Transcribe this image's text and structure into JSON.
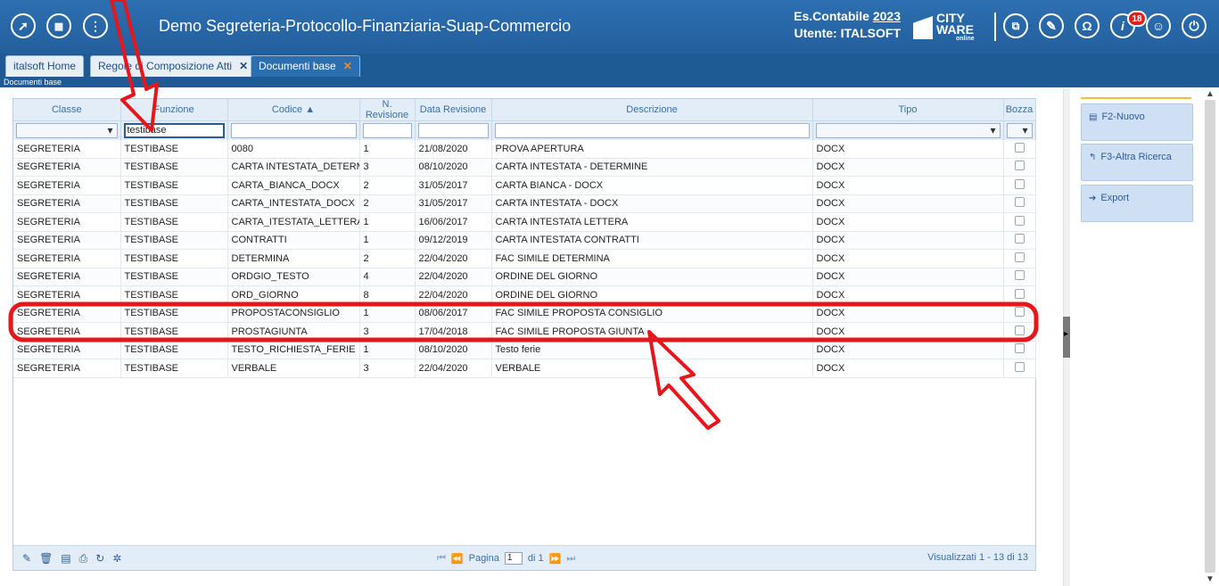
{
  "header": {
    "title": "Demo Segreteria-Protocollo-Finanziaria-Suap-Commercio",
    "es_label": "Es.Contabile",
    "es_year": "2023",
    "user_label": "Utente: ITALSOFT",
    "logo_line1": "CITY",
    "logo_line2": "WARE",
    "logo_line3": "online",
    "notifications": "18",
    "left_icons": [
      "rocket-icon",
      "apps-grid-icon",
      "info-menu-icon"
    ],
    "right_icons": [
      "windows-icon",
      "edit-icon",
      "headset-icon",
      "info-icon",
      "user-icon",
      "power-icon"
    ]
  },
  "tabs": [
    {
      "label": "italsoft Home",
      "closable": false,
      "active": false
    },
    {
      "label": "Regole di Composizione Atti",
      "closable": true,
      "active": false
    },
    {
      "label": "Documenti base",
      "closable": true,
      "active": true
    }
  ],
  "breadcrumb": "Documenti base",
  "grid": {
    "columns": [
      "Classe",
      "Funzione",
      "Codice ▲",
      "N. Revisione",
      "Data Revisione",
      "Descrizione",
      "Tipo",
      "Bozza"
    ],
    "filters": {
      "funzione": "testibase"
    },
    "rows": [
      [
        "SEGRETERIA",
        "TESTIBASE",
        "0080",
        "1",
        "21/08/2020",
        "PROVA APERTURA",
        "DOCX"
      ],
      [
        "SEGRETERIA",
        "TESTIBASE",
        "CARTA INTESTATA_DETERMINE",
        "3",
        "08/10/2020",
        "CARTA INTESTATA - DETERMINE",
        "DOCX"
      ],
      [
        "SEGRETERIA",
        "TESTIBASE",
        "CARTA_BIANCA_DOCX",
        "2",
        "31/05/2017",
        "CARTA BIANCA - DOCX",
        "DOCX"
      ],
      [
        "SEGRETERIA",
        "TESTIBASE",
        "CARTA_INTESTATA_DOCX",
        "2",
        "31/05/2017",
        "CARTA INTESTATA - DOCX",
        "DOCX"
      ],
      [
        "SEGRETERIA",
        "TESTIBASE",
        "CARTA_ITESTATA_LETTERA",
        "1",
        "16/06/2017",
        "CARTA INTESTATA LETTERA",
        "DOCX"
      ],
      [
        "SEGRETERIA",
        "TESTIBASE",
        "CONTRATTI",
        "1",
        "09/12/2019",
        "CARTA INTESTATA CONTRATTI",
        "DOCX"
      ],
      [
        "SEGRETERIA",
        "TESTIBASE",
        "DETERMINA",
        "2",
        "22/04/2020",
        "FAC SIMILE DETERMINA",
        "DOCX"
      ],
      [
        "SEGRETERIA",
        "TESTIBASE",
        "ORDGIO_TESTO",
        "4",
        "22/04/2020",
        "ORDINE DEL GIORNO",
        "DOCX"
      ],
      [
        "SEGRETERIA",
        "TESTIBASE",
        "ORD_GIORNO",
        "8",
        "22/04/2020",
        "ORDINE DEL GIORNO",
        "DOCX"
      ],
      [
        "SEGRETERIA",
        "TESTIBASE",
        "PROPOSTACONSIGLIO",
        "1",
        "08/06/2017",
        "FAC SIMILE PROPOSTA CONSIGLIO",
        "DOCX"
      ],
      [
        "SEGRETERIA",
        "TESTIBASE",
        "PROSTAGIUNTA",
        "3",
        "17/04/2018",
        "FAC SIMILE PROPOSTA GIUNTA",
        "DOCX"
      ],
      [
        "SEGRETERIA",
        "TESTIBASE",
        "TESTO_RICHIESTA_FERIE",
        "1",
        "08/10/2020",
        "Testo ferie",
        "DOCX"
      ],
      [
        "SEGRETERIA",
        "TESTIBASE",
        "VERBALE",
        "3",
        "22/04/2020",
        "VERBALE",
        "DOCX"
      ]
    ]
  },
  "pager": {
    "page_label": "Pagina",
    "page_value": "1",
    "of_label": "di 1",
    "shown_label": "Visualizzati 1 - 13 di 13",
    "tools": [
      "edit-icon",
      "delete-icon",
      "save-icon",
      "print-icon",
      "refresh-icon",
      "settings-icon"
    ]
  },
  "side": {
    "new_label": "F2-Nuovo",
    "search_label": "F3-Altra Ricerca",
    "export_label": "Export"
  },
  "colors": {
    "header_bg": "#2c6fb1",
    "annotation_red": "#e8151b",
    "notification_badge": "#e02020",
    "side_accent": "#f2c230"
  }
}
